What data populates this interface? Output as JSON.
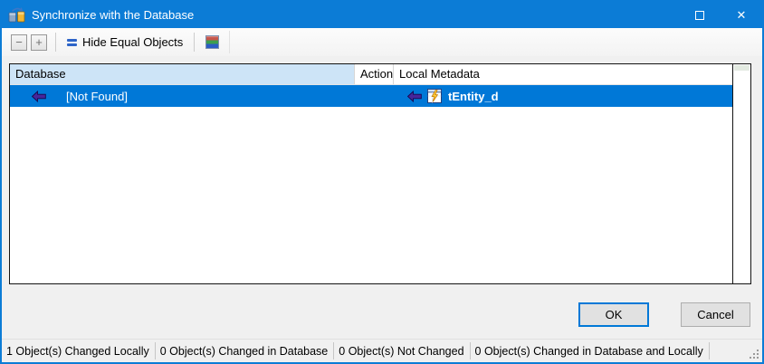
{
  "window": {
    "title": "Synchronize with the Database"
  },
  "titlebar": {
    "close_glyph": "✕"
  },
  "toolbar": {
    "minus_glyph": "−",
    "plus_glyph": "+",
    "hide_equal_label": "Hide Equal Objects"
  },
  "table": {
    "columns": [
      "Database",
      "Action",
      "Local Metadata"
    ],
    "rows": [
      {
        "database": "[Not Found]",
        "action": "",
        "local_metadata": "tEntity_d",
        "selected": true
      }
    ]
  },
  "buttons": {
    "ok_label": "OK",
    "cancel_label": "Cancel"
  },
  "statusbar": {
    "sections": [
      "1 Object(s) Changed Locally",
      "0 Object(s) Changed in Database",
      "0 Object(s) Not Changed",
      "0 Object(s) Changed in Database and Locally"
    ]
  },
  "colors": {
    "titlebar_blue": "#0c7cd6",
    "selection_blue": "#0078d7",
    "header_highlight": "#cde4f7",
    "focus_border": "#0078d7",
    "arrow_purple": "#46269b",
    "table_border": "#141414"
  }
}
